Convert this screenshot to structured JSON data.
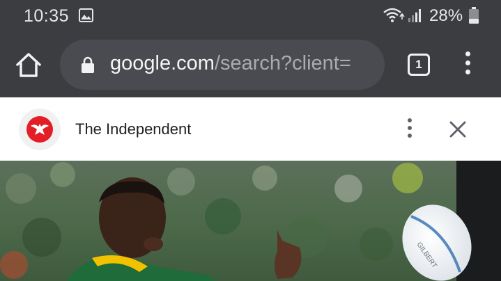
{
  "status_bar": {
    "time": "10:35",
    "battery": "28%",
    "icons": [
      "image-icon",
      "wifi-icon",
      "signal-icon",
      "battery-icon"
    ]
  },
  "toolbar": {
    "url_host": "google.com",
    "url_path": "/search?client=",
    "tab_count": "1",
    "icons": [
      "home-icon",
      "lock-icon",
      "tab-switcher-icon",
      "more-vert-icon"
    ]
  },
  "source": {
    "title": "The Independent",
    "brand_color": "#e31e26",
    "icons": [
      "eagle-logo-icon",
      "more-vert-icon",
      "close-icon"
    ]
  },
  "article": {
    "image_subject": "rugby player in green and yellow jersey passing a ball, crowd background"
  },
  "colors": {
    "chrome_bg": "#3c3d41",
    "url_bar_bg": "#4a4b50",
    "header_bg": "#ffffff"
  }
}
